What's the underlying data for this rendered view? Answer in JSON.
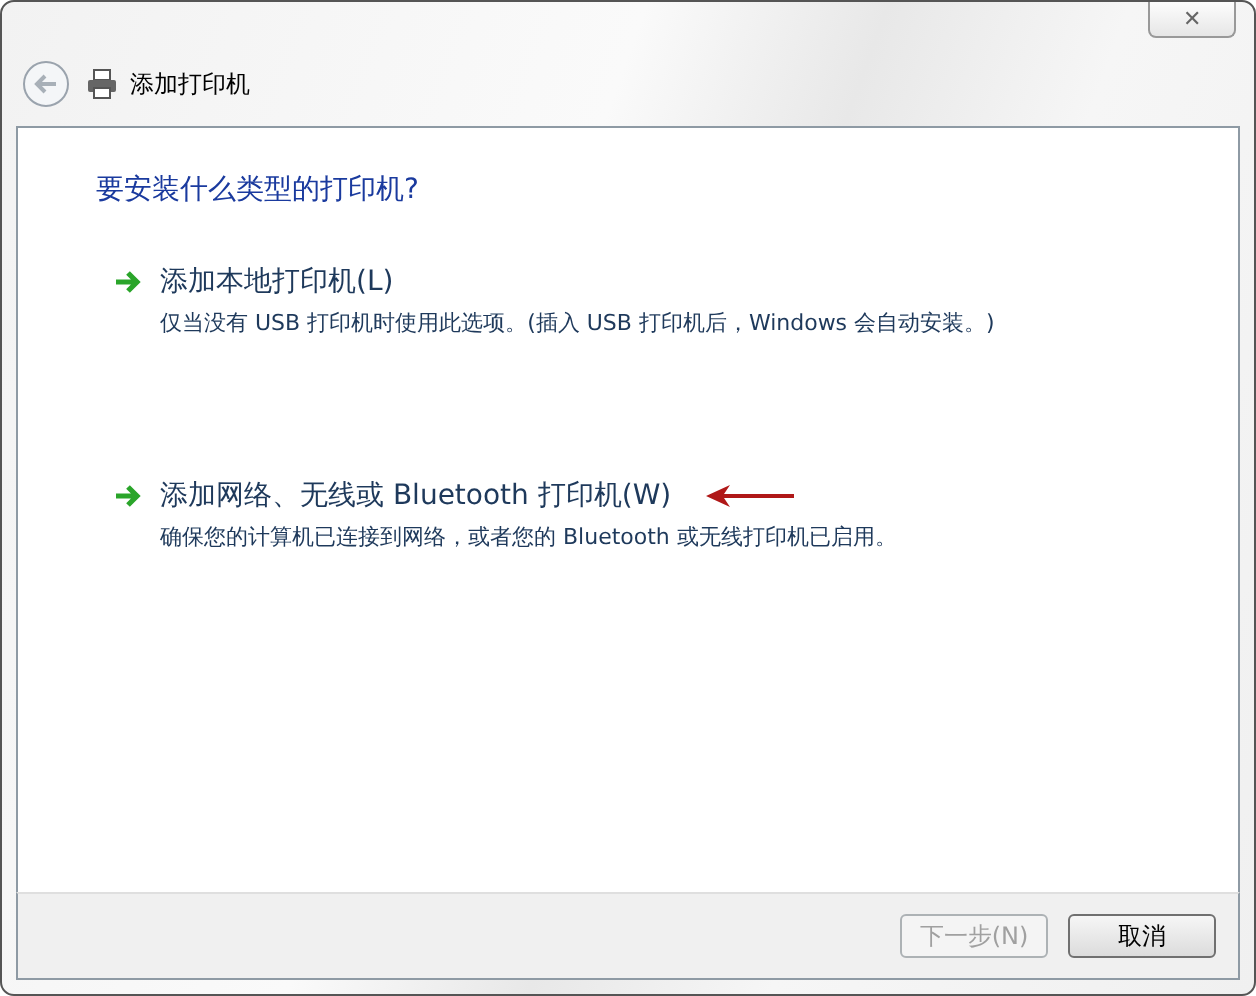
{
  "window": {
    "title": "添加打印机",
    "close": "✕"
  },
  "heading": "要安装什么类型的打印机?",
  "options": [
    {
      "title": "添加本地打印机(L)",
      "description": "仅当没有 USB 打印机时使用此选项。(插入 USB 打印机后，Windows 会自动安装。)",
      "pointed": false
    },
    {
      "title": "添加网络、无线或 Bluetooth 打印机(W)",
      "description": "确保您的计算机已连接到网络，或者您的 Bluetooth 或无线打印机已启用。",
      "pointed": true
    }
  ],
  "buttons": [
    {
      "label": "下一步(N)",
      "disabled": true
    },
    {
      "label": "取消",
      "disabled": false
    }
  ]
}
